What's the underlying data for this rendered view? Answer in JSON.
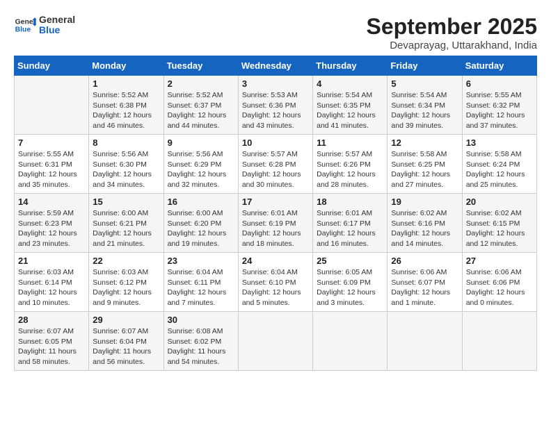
{
  "header": {
    "logo_line1": "General",
    "logo_line2": "Blue",
    "title": "September 2025",
    "subtitle": "Devaprayag, Uttarakhand, India"
  },
  "weekdays": [
    "Sunday",
    "Monday",
    "Tuesday",
    "Wednesday",
    "Thursday",
    "Friday",
    "Saturday"
  ],
  "weeks": [
    [
      {
        "day": "",
        "info": ""
      },
      {
        "day": "1",
        "info": "Sunrise: 5:52 AM\nSunset: 6:38 PM\nDaylight: 12 hours\nand 46 minutes."
      },
      {
        "day": "2",
        "info": "Sunrise: 5:52 AM\nSunset: 6:37 PM\nDaylight: 12 hours\nand 44 minutes."
      },
      {
        "day": "3",
        "info": "Sunrise: 5:53 AM\nSunset: 6:36 PM\nDaylight: 12 hours\nand 43 minutes."
      },
      {
        "day": "4",
        "info": "Sunrise: 5:54 AM\nSunset: 6:35 PM\nDaylight: 12 hours\nand 41 minutes."
      },
      {
        "day": "5",
        "info": "Sunrise: 5:54 AM\nSunset: 6:34 PM\nDaylight: 12 hours\nand 39 minutes."
      },
      {
        "day": "6",
        "info": "Sunrise: 5:55 AM\nSunset: 6:32 PM\nDaylight: 12 hours\nand 37 minutes."
      }
    ],
    [
      {
        "day": "7",
        "info": "Sunrise: 5:55 AM\nSunset: 6:31 PM\nDaylight: 12 hours\nand 35 minutes."
      },
      {
        "day": "8",
        "info": "Sunrise: 5:56 AM\nSunset: 6:30 PM\nDaylight: 12 hours\nand 34 minutes."
      },
      {
        "day": "9",
        "info": "Sunrise: 5:56 AM\nSunset: 6:29 PM\nDaylight: 12 hours\nand 32 minutes."
      },
      {
        "day": "10",
        "info": "Sunrise: 5:57 AM\nSunset: 6:28 PM\nDaylight: 12 hours\nand 30 minutes."
      },
      {
        "day": "11",
        "info": "Sunrise: 5:57 AM\nSunset: 6:26 PM\nDaylight: 12 hours\nand 28 minutes."
      },
      {
        "day": "12",
        "info": "Sunrise: 5:58 AM\nSunset: 6:25 PM\nDaylight: 12 hours\nand 27 minutes."
      },
      {
        "day": "13",
        "info": "Sunrise: 5:58 AM\nSunset: 6:24 PM\nDaylight: 12 hours\nand 25 minutes."
      }
    ],
    [
      {
        "day": "14",
        "info": "Sunrise: 5:59 AM\nSunset: 6:23 PM\nDaylight: 12 hours\nand 23 minutes."
      },
      {
        "day": "15",
        "info": "Sunrise: 6:00 AM\nSunset: 6:21 PM\nDaylight: 12 hours\nand 21 minutes."
      },
      {
        "day": "16",
        "info": "Sunrise: 6:00 AM\nSunset: 6:20 PM\nDaylight: 12 hours\nand 19 minutes."
      },
      {
        "day": "17",
        "info": "Sunrise: 6:01 AM\nSunset: 6:19 PM\nDaylight: 12 hours\nand 18 minutes."
      },
      {
        "day": "18",
        "info": "Sunrise: 6:01 AM\nSunset: 6:17 PM\nDaylight: 12 hours\nand 16 minutes."
      },
      {
        "day": "19",
        "info": "Sunrise: 6:02 AM\nSunset: 6:16 PM\nDaylight: 12 hours\nand 14 minutes."
      },
      {
        "day": "20",
        "info": "Sunrise: 6:02 AM\nSunset: 6:15 PM\nDaylight: 12 hours\nand 12 minutes."
      }
    ],
    [
      {
        "day": "21",
        "info": "Sunrise: 6:03 AM\nSunset: 6:14 PM\nDaylight: 12 hours\nand 10 minutes."
      },
      {
        "day": "22",
        "info": "Sunrise: 6:03 AM\nSunset: 6:12 PM\nDaylight: 12 hours\nand 9 minutes."
      },
      {
        "day": "23",
        "info": "Sunrise: 6:04 AM\nSunset: 6:11 PM\nDaylight: 12 hours\nand 7 minutes."
      },
      {
        "day": "24",
        "info": "Sunrise: 6:04 AM\nSunset: 6:10 PM\nDaylight: 12 hours\nand 5 minutes."
      },
      {
        "day": "25",
        "info": "Sunrise: 6:05 AM\nSunset: 6:09 PM\nDaylight: 12 hours\nand 3 minutes."
      },
      {
        "day": "26",
        "info": "Sunrise: 6:06 AM\nSunset: 6:07 PM\nDaylight: 12 hours\nand 1 minute."
      },
      {
        "day": "27",
        "info": "Sunrise: 6:06 AM\nSunset: 6:06 PM\nDaylight: 12 hours\nand 0 minutes."
      }
    ],
    [
      {
        "day": "28",
        "info": "Sunrise: 6:07 AM\nSunset: 6:05 PM\nDaylight: 11 hours\nand 58 minutes."
      },
      {
        "day": "29",
        "info": "Sunrise: 6:07 AM\nSunset: 6:04 PM\nDaylight: 11 hours\nand 56 minutes."
      },
      {
        "day": "30",
        "info": "Sunrise: 6:08 AM\nSunset: 6:02 PM\nDaylight: 11 hours\nand 54 minutes."
      },
      {
        "day": "",
        "info": ""
      },
      {
        "day": "",
        "info": ""
      },
      {
        "day": "",
        "info": ""
      },
      {
        "day": "",
        "info": ""
      }
    ]
  ]
}
